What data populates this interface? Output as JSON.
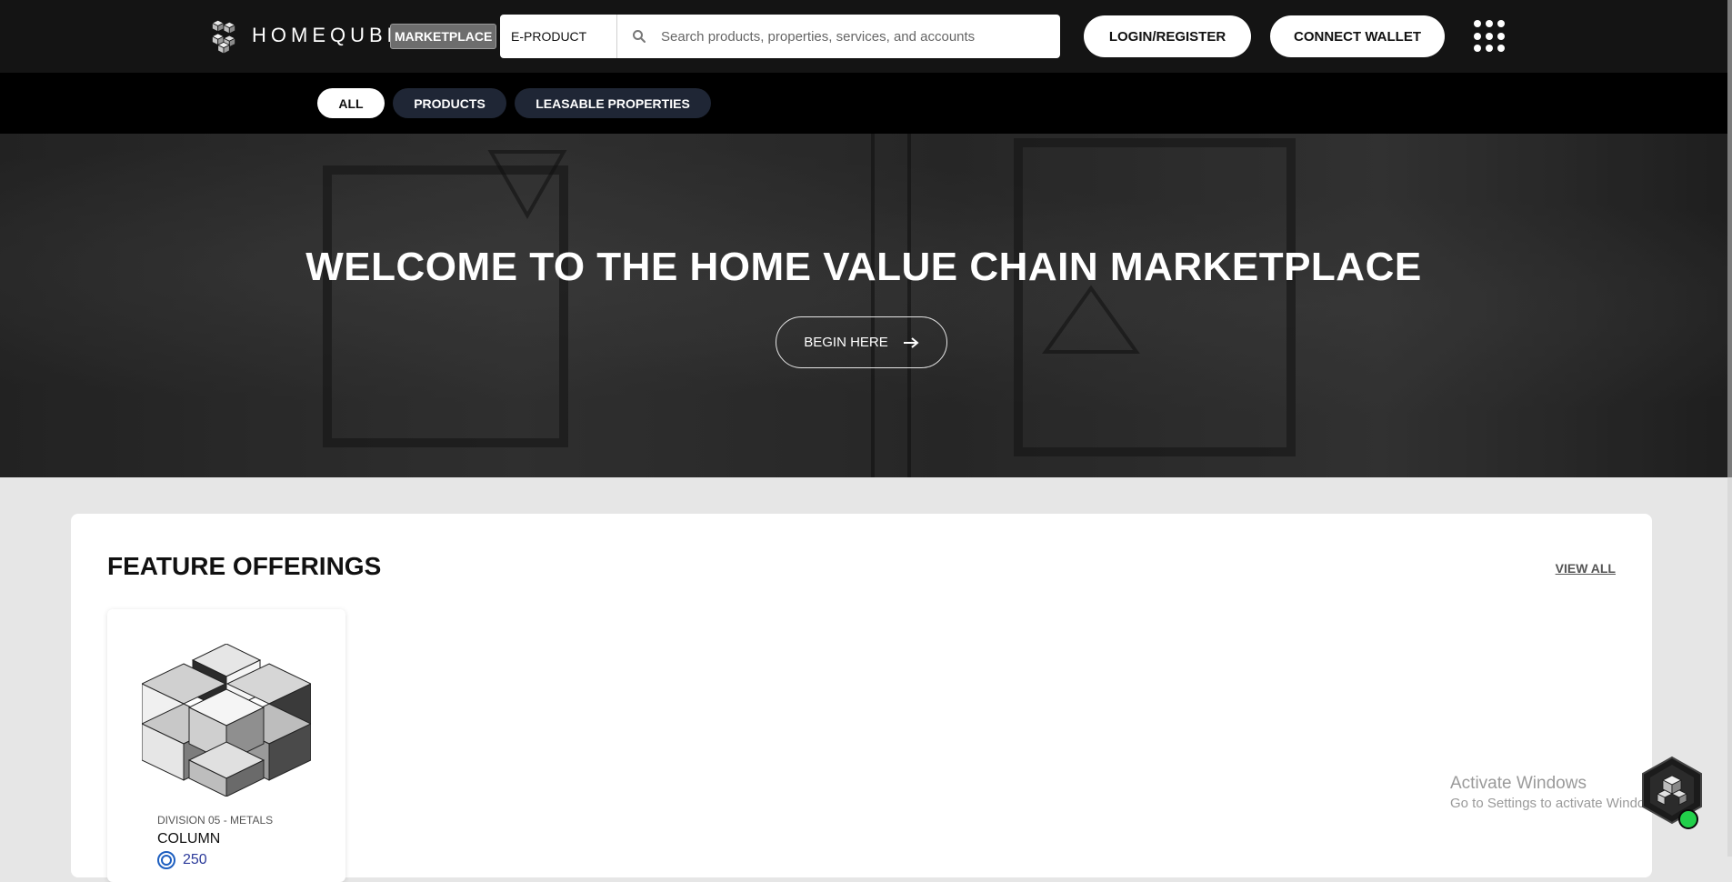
{
  "header": {
    "brand_name": "HOMEQUBE",
    "marketplace_badge": "MARKETPLACE",
    "search": {
      "category": "E-PRODUCT",
      "placeholder": "Search products, properties, services, and accounts"
    },
    "login_label": "LOGIN/REGISTER",
    "wallet_label": "CONNECT WALLET",
    "apps_icon": "grid-dots-icon"
  },
  "categories": [
    {
      "label": "ALL",
      "active": true
    },
    {
      "label": "PRODUCTS",
      "active": false
    },
    {
      "label": "LEASABLE PROPERTIES",
      "active": false
    }
  ],
  "hero": {
    "title": "WELCOME TO THE HOME VALUE CHAIN MARKETPLACE",
    "cta_label": "BEGIN HERE"
  },
  "featured": {
    "title": "FEATURE OFFERINGS",
    "view_all_label": "VIEW ALL",
    "items": [
      {
        "category": "DIVISION 05 - METALS",
        "name": "COLUMN",
        "price": "250"
      }
    ]
  },
  "watermark": {
    "line1": "Activate Windows",
    "line2": "Go to Settings to activate Windows."
  },
  "colors": {
    "topbar_bg": "#141414",
    "catbar_bg": "#000000",
    "pill_inactive": "#1f2635",
    "status_online": "#21d04a"
  }
}
